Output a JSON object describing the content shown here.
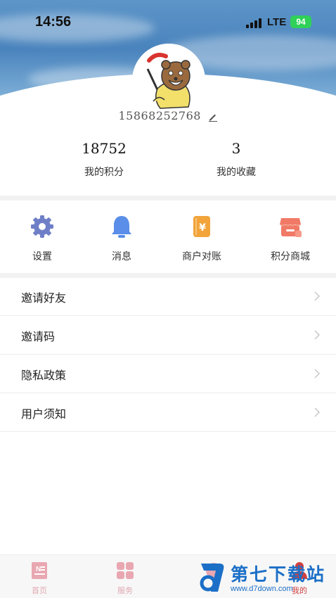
{
  "status_bar": {
    "time": "14:56",
    "network": "LTE",
    "battery": "94"
  },
  "profile": {
    "phone": "15868252768"
  },
  "stats": [
    {
      "value": "18752",
      "label": "我的积分"
    },
    {
      "value": "3",
      "label": "我的收藏"
    }
  ],
  "menu": [
    {
      "label": "设置",
      "icon": "gear-icon",
      "color": "#6f7fc7"
    },
    {
      "label": "消息",
      "icon": "bell-icon",
      "color": "#5a8ee8"
    },
    {
      "label": "商户对账",
      "icon": "yuan-book-icon",
      "color": "#f2a33a"
    },
    {
      "label": "积分商城",
      "icon": "store-icon",
      "color": "#f07a66"
    }
  ],
  "list": [
    {
      "label": "邀请好友"
    },
    {
      "label": "邀请码"
    },
    {
      "label": "隐私政策"
    },
    {
      "label": "用户须知"
    }
  ],
  "tabs": [
    {
      "label": "首页",
      "icon": "home-news-icon"
    },
    {
      "label": "服务",
      "icon": "grid-icon"
    },
    {
      "label": "",
      "icon": "circle-icon"
    },
    {
      "label": "我的",
      "icon": "person-icon",
      "active": true
    }
  ],
  "watermark": {
    "title": "第七下载站",
    "url": "www.d7down.com"
  },
  "colors": {
    "accent": "#d23f3f",
    "tab_inactive": "#e1a9b2",
    "separator": "#f2f2f2"
  }
}
